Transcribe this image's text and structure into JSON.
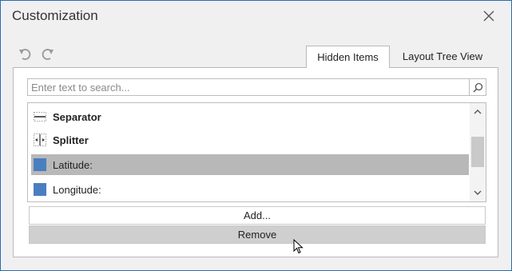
{
  "window": {
    "title": "Customization",
    "close_icon": "close-icon",
    "undo_icon": "undo-icon",
    "redo_icon": "redo-icon"
  },
  "tabs": [
    {
      "label": "Hidden Items",
      "active": true
    },
    {
      "label": "Layout Tree View",
      "active": false
    }
  ],
  "search": {
    "placeholder": "Enter text to search...",
    "icon": "search-icon"
  },
  "list": {
    "items": [
      {
        "label": "Separator",
        "icon": "separator-icon",
        "bold": true,
        "selected": false
      },
      {
        "label": "Splitter",
        "icon": "splitter-icon",
        "bold": true,
        "selected": false
      },
      {
        "label": "Latitude:",
        "icon": "field-icon",
        "bold": false,
        "selected": true
      },
      {
        "label": "Longitude:",
        "icon": "field-icon",
        "bold": false,
        "selected": false
      }
    ]
  },
  "buttons": {
    "add_label": "Add...",
    "remove_label": "Remove"
  },
  "colors": {
    "window_border": "#2b6cb0",
    "field_icon": "#4a7fbf",
    "selection": "#b8b8b8"
  }
}
